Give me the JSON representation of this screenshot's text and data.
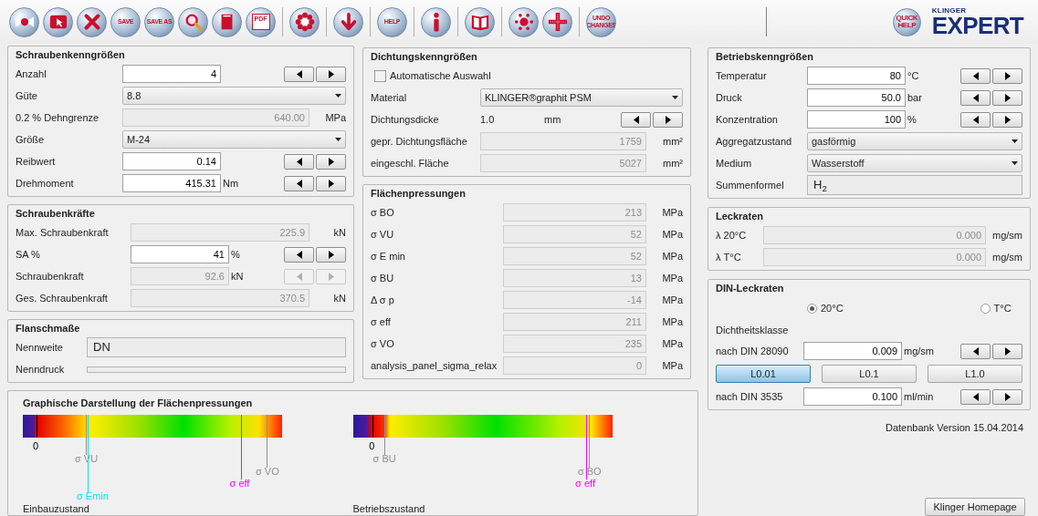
{
  "toolbar": {
    "groups": [
      [
        {
          "kind": "bowtie"
        },
        {
          "kind": "cursor"
        },
        {
          "kind": "close"
        },
        {
          "kind": "text",
          "label": "SAVE"
        },
        {
          "kind": "text",
          "label": "SAVE AS"
        },
        {
          "kind": "search"
        },
        {
          "kind": "book"
        },
        {
          "kind": "doc",
          "label": "PDF"
        }
      ],
      [
        {
          "kind": "flower"
        }
      ],
      [
        {
          "kind": "down"
        }
      ],
      [
        {
          "kind": "text",
          "label": "HELP"
        }
      ],
      [
        {
          "kind": "info"
        }
      ],
      [
        {
          "kind": "openbook"
        }
      ],
      [
        {
          "kind": "dots"
        },
        {
          "kind": "ruler"
        }
      ],
      [
        {
          "kind": "text",
          "label": "UNDO CHANGES"
        }
      ]
    ],
    "quick_help": "QUICK HELP",
    "logo": {
      "brand": "KLINGER",
      "product": "EXPERT"
    }
  },
  "left": [
    {
      "title": "Schraubenkenngrößen",
      "rows": [
        {
          "kind": "input",
          "label": "Anzahl",
          "value": "4",
          "stepper": {
            "disabled": false
          }
        },
        {
          "kind": "select",
          "label": "Güte",
          "value": "8.8"
        },
        {
          "kind": "readonly",
          "label": "0.2 % Dehngrenze",
          "value": "640.00",
          "unit": "MPa"
        },
        {
          "kind": "select",
          "label": "Größe",
          "value": "M-24"
        },
        {
          "kind": "input",
          "label": "Reibwert",
          "value": "0.14",
          "stepper": {
            "disabled": false
          }
        },
        {
          "kind": "input",
          "label": "Drehmoment",
          "value": "415.31",
          "unit": "Nm",
          "stepper": {
            "disabled": false
          }
        }
      ]
    },
    {
      "title": "Schraubenkräfte",
      "rows": [
        {
          "kind": "readonly",
          "label": "Max. Schraubenkraft",
          "value": "225.9",
          "unit": "kN"
        },
        {
          "kind": "input",
          "label": "SA %",
          "value": "41",
          "unit": "%",
          "stepper": {
            "disabled": false
          }
        },
        {
          "kind": "readonly",
          "label": "Schraubenkraft",
          "value": "92.6",
          "unit": "kN",
          "stepper": {
            "disabled": true
          }
        },
        {
          "kind": "readonly",
          "label": "Ges. Schraubenkraft",
          "value": "370.5",
          "unit": "kN"
        }
      ]
    },
    {
      "title": "Flanschmaße",
      "rows": [
        {
          "kind": "textfield",
          "label": "Nennweite",
          "value": "DN"
        },
        {
          "kind": "textfield",
          "label": "Nenndruck"
        }
      ]
    }
  ],
  "middle": [
    {
      "title": "Dichtungskenngrößen",
      "rows": [
        {
          "kind": "checkbox",
          "label": "Automatische Auswahl",
          "checked": false
        },
        {
          "kind": "select",
          "label": "Material",
          "value": "KLINGER®graphit PSM"
        },
        {
          "kind": "text",
          "label": "Dichtungsdicke",
          "value": "1.0",
          "unit": "mm",
          "stepper": {
            "disabled": false
          }
        },
        {
          "kind": "readonly",
          "label": "gepr. Dichtungsfläche",
          "value": "1759",
          "unit": "mm²"
        },
        {
          "kind": "readonly",
          "label": "eingeschl. Fläche",
          "value": "5027",
          "unit": "mm²"
        }
      ]
    },
    {
      "title": "Flächenpressungen",
      "rows": [
        {
          "kind": "readonly",
          "label": "σ BO",
          "value": "213",
          "unit": "MPa"
        },
        {
          "kind": "readonly",
          "label": "σ VU",
          "value": "52",
          "unit": "MPa"
        },
        {
          "kind": "readonly",
          "label": "σ E min",
          "value": "52",
          "unit": "MPa"
        },
        {
          "kind": "readonly",
          "label": "σ BU",
          "value": "13",
          "unit": "MPa"
        },
        {
          "kind": "readonly",
          "label": "Δ σ p",
          "value": "-14",
          "unit": "MPa"
        },
        {
          "kind": "readonly",
          "label": "σ eff",
          "value": "211",
          "unit": "MPa"
        },
        {
          "kind": "readonly",
          "label": "σ VO",
          "value": "235",
          "unit": "MPa"
        },
        {
          "kind": "readonly",
          "label": "analysis_panel_sigma_relax",
          "value": "0",
          "unit": "MPa"
        }
      ]
    }
  ],
  "right": [
    {
      "title": "Betriebskenngrößen",
      "rows": [
        {
          "kind": "input",
          "label": "Temperatur",
          "value": "80",
          "unit": "°C",
          "stepper": {
            "disabled": false
          }
        },
        {
          "kind": "input",
          "label": "Druck",
          "value": "50.0",
          "unit": "bar",
          "stepper": {
            "disabled": false
          }
        },
        {
          "kind": "input",
          "label": "Konzentration",
          "value": "100",
          "unit": "%",
          "stepper": {
            "disabled": false
          }
        },
        {
          "kind": "select",
          "label": "Aggregatzustand",
          "value": "gasförmig"
        },
        {
          "kind": "select",
          "label": "Medium",
          "value": "Wasserstoff"
        },
        {
          "kind": "textfield",
          "label": "Summenformel",
          "value": "H$_{2}$"
        }
      ]
    },
    {
      "title": "Leckraten",
      "rows": [
        {
          "kind": "readonly",
          "label": "λ 20°C",
          "value": "0.000",
          "unit": "mg/sm"
        },
        {
          "kind": "readonly",
          "label": "λ T°C",
          "value": "0.000",
          "unit": "mg/sm"
        }
      ]
    },
    {
      "title": "DIN-Leckraten",
      "rows": [
        {
          "kind": "radios",
          "options": [
            {
              "label": "20°C",
              "selected": true
            },
            {
              "label": "T°C",
              "selected": false
            }
          ]
        },
        {
          "kind": "caption",
          "label": "Dichtheitsklasse"
        },
        {
          "kind": "input",
          "label": "nach DIN 28090",
          "value": "0.009",
          "unit": "mg/sm",
          "stepper": {
            "disabled": false
          }
        },
        {
          "kind": "classes",
          "options": [
            {
              "label": "L0.01",
              "selected": true
            },
            {
              "label": "L0.1",
              "selected": false
            },
            {
              "label": "L1.0",
              "selected": false
            }
          ]
        },
        {
          "kind": "input",
          "label": "nach DIN 3535",
          "value": "0.100",
          "unit": "ml/min",
          "stepper": {
            "disabled": false
          }
        }
      ]
    }
  ],
  "version": "Datenbank Version 15.04.2014",
  "homepage_button": "Klinger Homepage",
  "graph": {
    "title": "Graphische Darstellung der Flächenpressungen",
    "charts": [
      {
        "caption": "Einbauzustand",
        "markers": [
          {
            "label": "0",
            "color": "#000000",
            "level": 0.053
          },
          {
            "label": "σ VU",
            "color": "#909090",
            "level": 0.243
          },
          {
            "label": "σ VO",
            "color": "#909090",
            "level": 0.94
          },
          {
            "label": "σ eff",
            "color": "#ff00ff",
            "level": 0.84
          },
          {
            "label": "σ Emin",
            "color": "#00e5ff",
            "level": 0.25
          }
        ]
      },
      {
        "caption": "Betriebszustand",
        "markers": [
          {
            "label": "0",
            "color": "#000000",
            "level": 0.077
          },
          {
            "label": "σ BU",
            "color": "#909090",
            "level": 0.12
          },
          {
            "label": "σ BO",
            "color": "#909090",
            "level": 0.91
          },
          {
            "label": "σ eff",
            "color": "#ff00ff",
            "level": 0.9
          }
        ]
      }
    ]
  }
}
